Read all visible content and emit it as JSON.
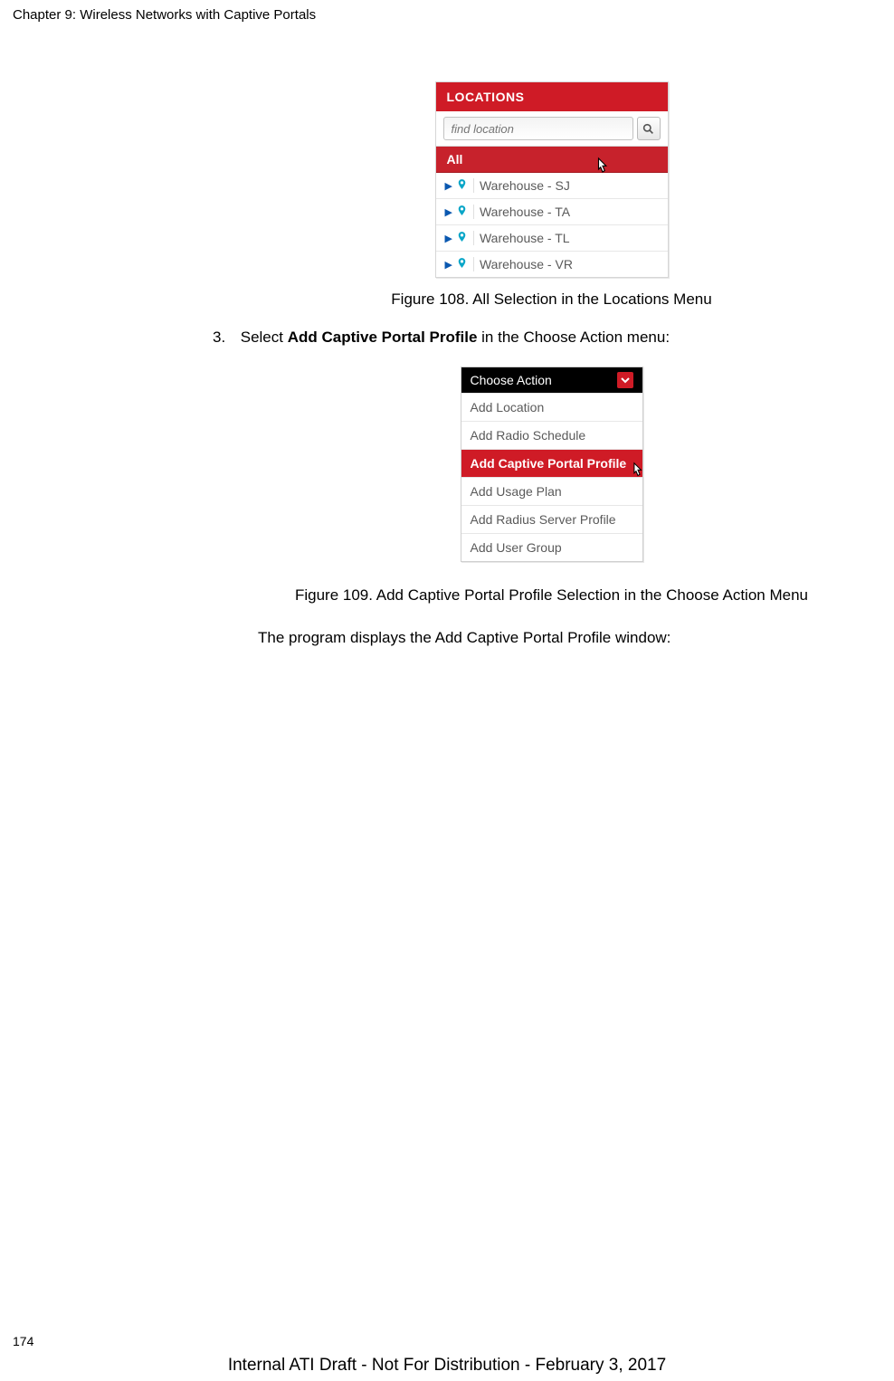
{
  "header": "Chapter 9: Wireless Networks with Captive Portals",
  "fig108": {
    "title": "LOCATIONS",
    "search_placeholder": "find location",
    "all_label": "All",
    "items": [
      {
        "name": "Warehouse - SJ"
      },
      {
        "name": "Warehouse - TA"
      },
      {
        "name": "Warehouse - TL"
      },
      {
        "name": "Warehouse - VR"
      }
    ],
    "caption": "Figure 108. All Selection in the Locations Menu"
  },
  "step": {
    "number": "3.",
    "prefix": "Select ",
    "bold": "Add Captive Portal Profile",
    "suffix": " in the Choose Action menu:"
  },
  "fig109": {
    "header": "Choose Action",
    "items": [
      {
        "label": "Add Location",
        "highlight": false
      },
      {
        "label": "Add Radio Schedule",
        "highlight": false
      },
      {
        "label": "Add Captive Portal Profile",
        "highlight": true
      },
      {
        "label": "Add Usage Plan",
        "highlight": false
      },
      {
        "label": "Add Radius Server Profile",
        "highlight": false
      },
      {
        "label": "Add User Group",
        "highlight": false
      }
    ],
    "caption": "Figure 109. Add Captive Portal Profile Selection in the Choose Action Menu"
  },
  "after_text": "The program displays the Add Captive Portal Profile window:",
  "page_number": "174",
  "footer": "Internal ATI Draft - Not For Distribution - February 3, 2017"
}
